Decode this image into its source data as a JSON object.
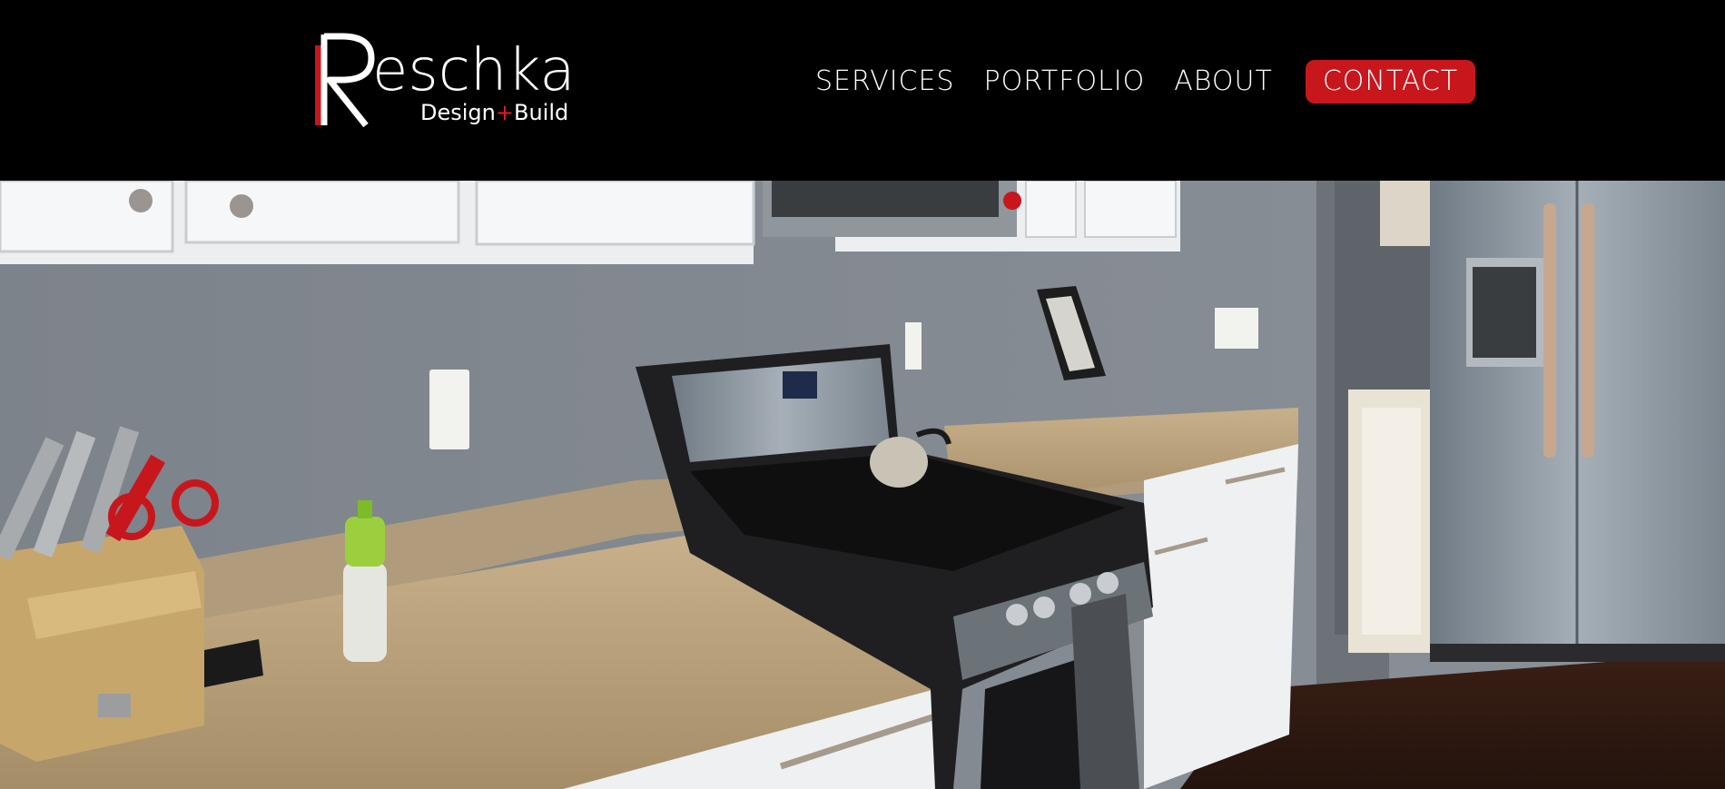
{
  "brand": {
    "name": "eschka",
    "initial": "R",
    "tagline_left": "Design",
    "tagline_plus": "+",
    "tagline_right": "Build",
    "colors": {
      "accent": "#c8161d",
      "background": "#000000",
      "text": "#ffffff"
    }
  },
  "nav": {
    "items": [
      {
        "label": "SERVICES"
      },
      {
        "label": "PORTFOLIO"
      },
      {
        "label": "ABOUT"
      }
    ],
    "cta": {
      "label": "CONTACT"
    }
  },
  "hero": {
    "image_subject": "kitchen-photo"
  }
}
